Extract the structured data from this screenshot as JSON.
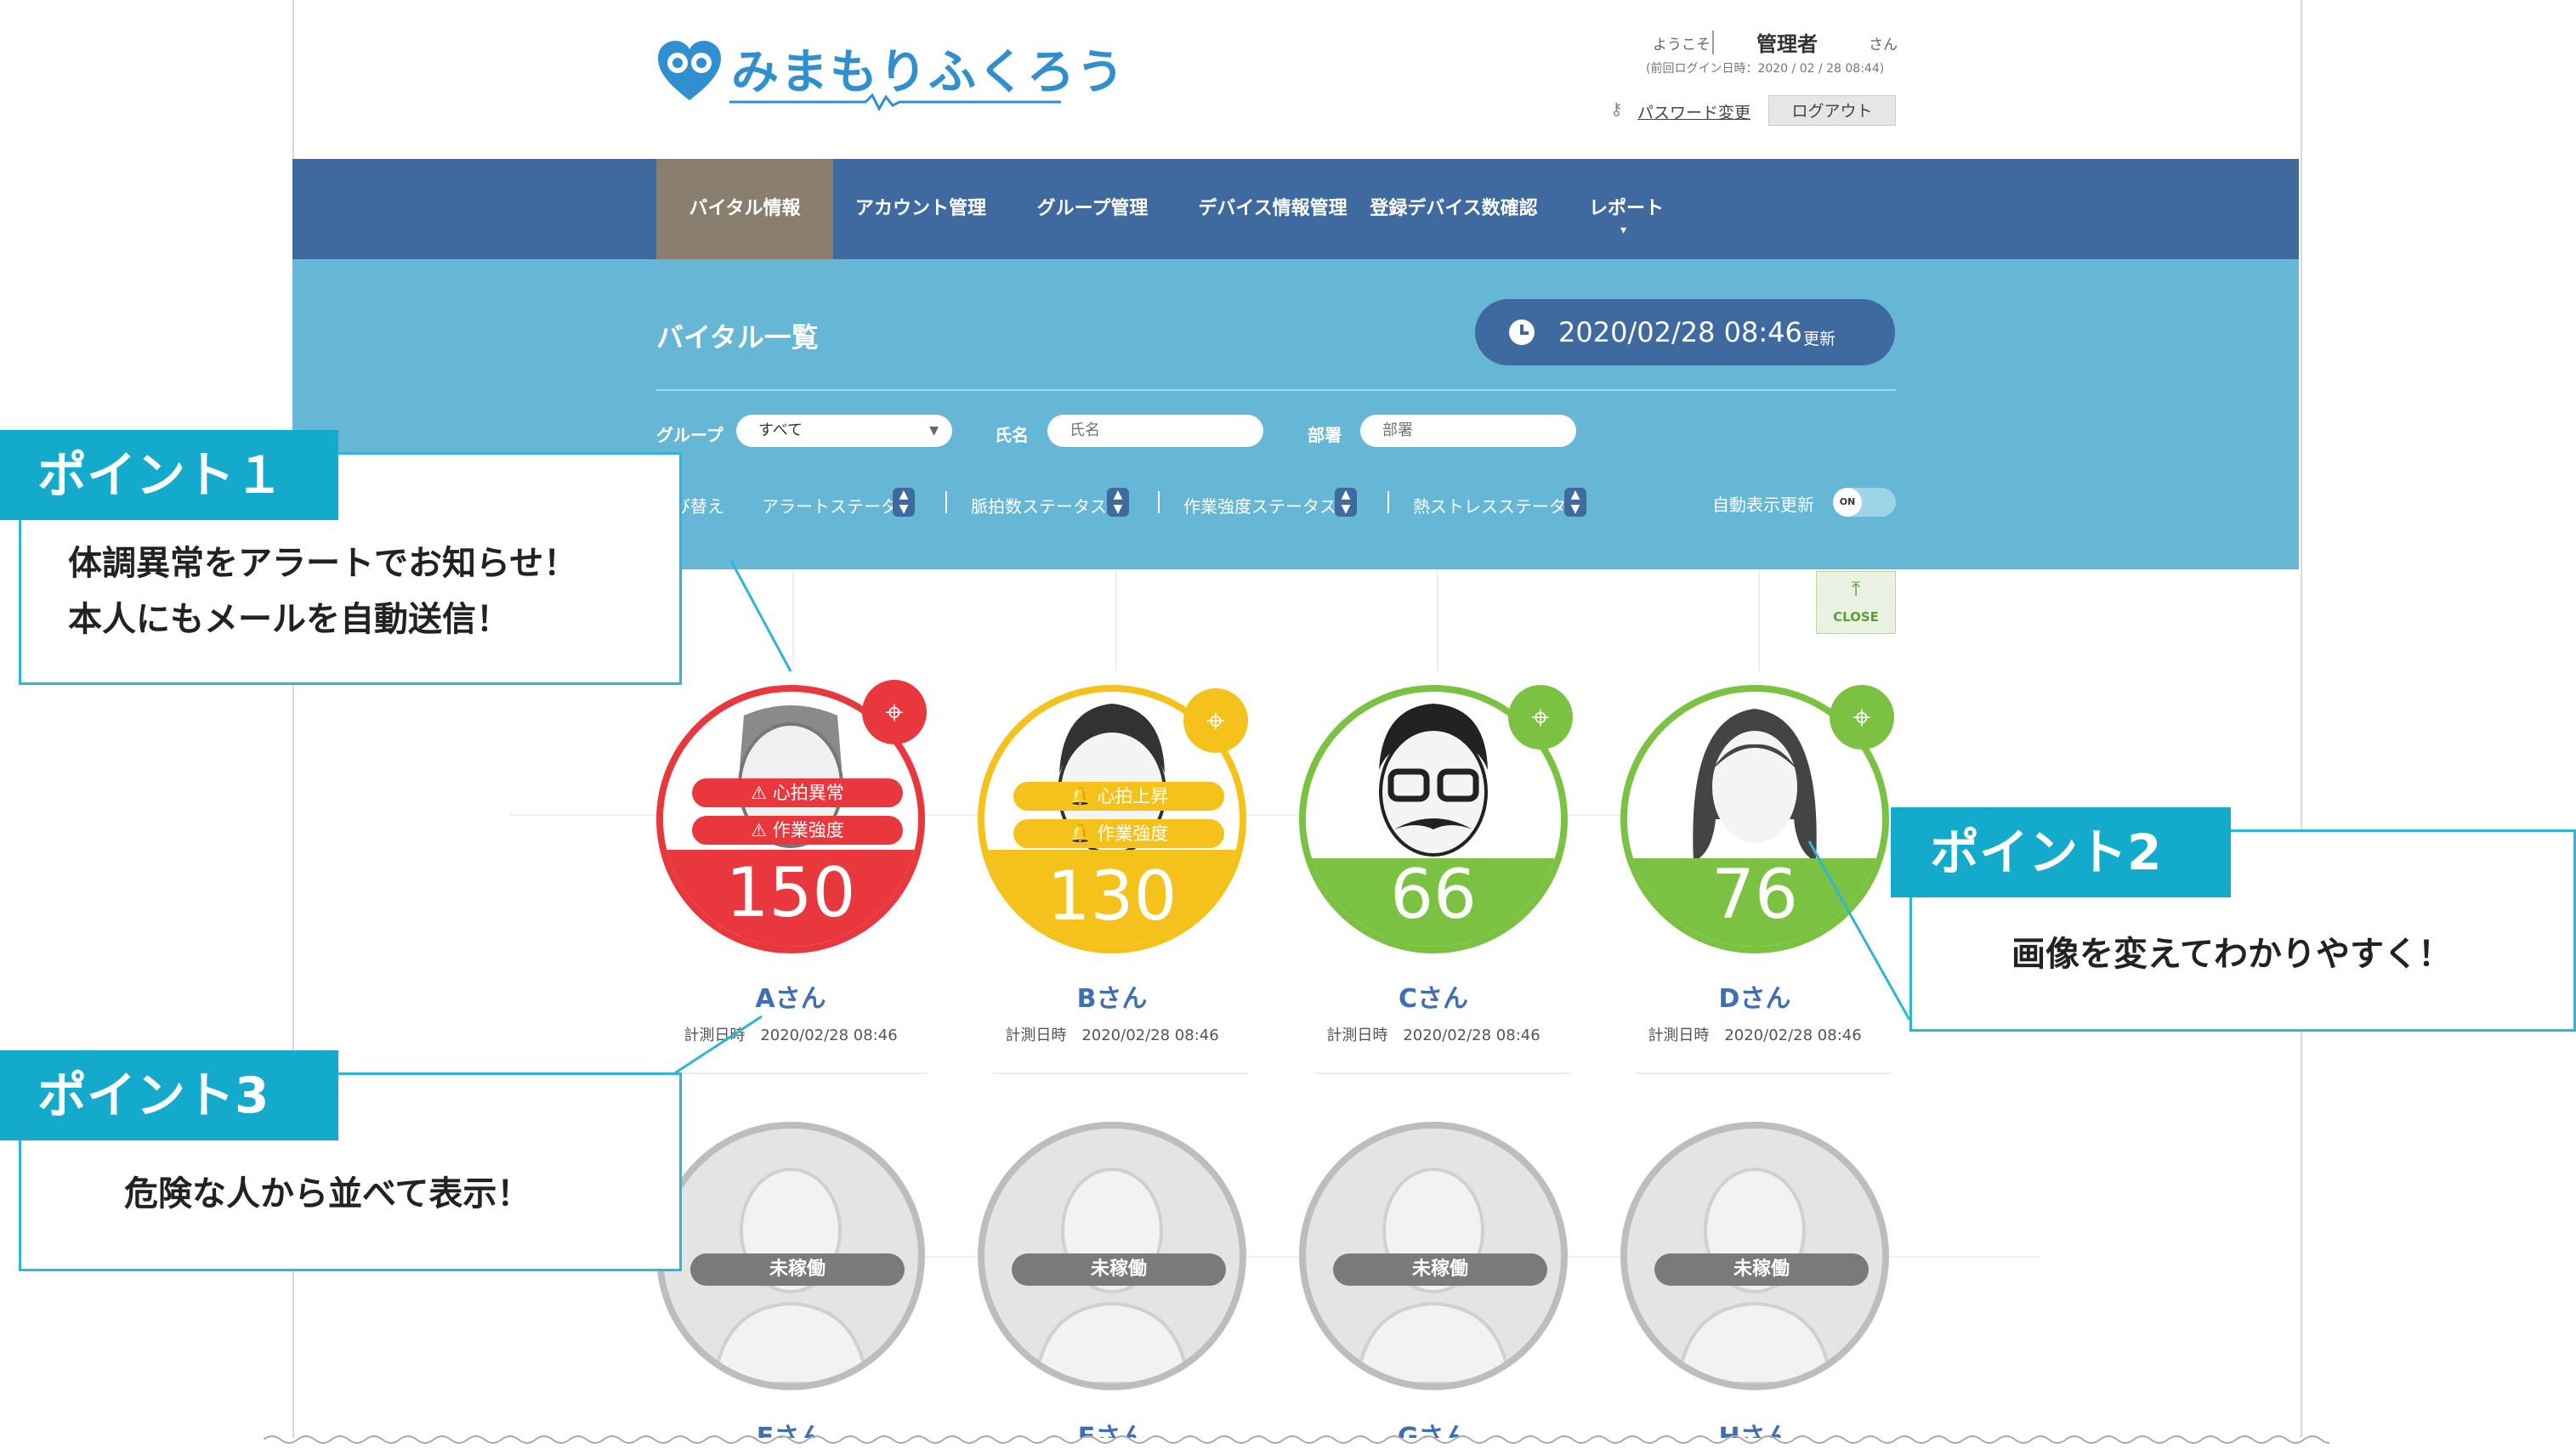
{
  "header": {
    "logo_text": "みまもりふくろう",
    "welcome": "ようこそ",
    "user_name": "管理者",
    "honorific": "さん",
    "last_login": "(前回ログイン日時：2020 / 02 / 28 08:44)",
    "password_change": "パスワード変更",
    "logout": "ログアウト"
  },
  "nav": {
    "items": [
      "バイタル情報",
      "アカウント管理",
      "グループ管理",
      "デバイス情報管理",
      "登録デバイス数確認",
      "レポート"
    ],
    "active_index": 0
  },
  "section": {
    "title": "バイタル一覧",
    "updated_time": "2020/02/28 08:46",
    "updated_suffix": "更新"
  },
  "filters": {
    "group_label": "グループ",
    "group_value": "すべて",
    "name_label": "氏名",
    "name_placeholder": "氏名",
    "dept_label": "部署",
    "dept_placeholder": "部署"
  },
  "sort": {
    "label": "並び替え",
    "options": [
      "アラートステータス",
      "脈拍数ステータス",
      "作業強度ステータス",
      "熱ストレスステータス"
    ],
    "auto_refresh_label": "自動表示更新",
    "auto_refresh_state": "ON",
    "close_label": "CLOSE"
  },
  "workers": [
    {
      "name": "Aさん",
      "value": "150",
      "status": "red",
      "alerts": [
        "心拍異常",
        "作業強度"
      ],
      "measured_label": "計測日時",
      "measured_at": "2020/02/28 08:46"
    },
    {
      "name": "Bさん",
      "value": "130",
      "status": "yellow",
      "alerts": [
        "心拍上昇",
        "作業強度"
      ],
      "measured_label": "計測日時",
      "measured_at": "2020/02/28 08:46"
    },
    {
      "name": "Cさん",
      "value": "66",
      "status": "green",
      "alerts": [],
      "measured_label": "計測日時",
      "measured_at": "2020/02/28 08:46"
    },
    {
      "name": "Dさん",
      "value": "76",
      "status": "green",
      "alerts": [],
      "measured_label": "計測日時",
      "measured_at": "2020/02/28 08:46"
    }
  ],
  "inactive_workers": [
    {
      "name": "Eさん",
      "status_label": "未稼働"
    },
    {
      "name": "Fさん",
      "status_label": "未稼働"
    },
    {
      "name": "Gさん",
      "status_label": "未稼働"
    },
    {
      "name": "Hさん",
      "status_label": "未稼働"
    }
  ],
  "callouts": [
    {
      "tag": "ポイント１",
      "lines": [
        "体調異常をアラートでお知らせ！",
        "本人にもメールを自動送信！"
      ]
    },
    {
      "tag": "ポイント2",
      "lines": [
        "画像を変えてわかりやすく！"
      ]
    },
    {
      "tag": "ポイント3",
      "lines": [
        "危険な人から並べて表示！"
      ]
    }
  ],
  "colors": {
    "red": "#e8383d",
    "yellow": "#f5c21b",
    "green": "#7cc242",
    "nav": "#3e6a9f",
    "filter_bg": "#66b7d5",
    "accent": "#14aacc"
  }
}
